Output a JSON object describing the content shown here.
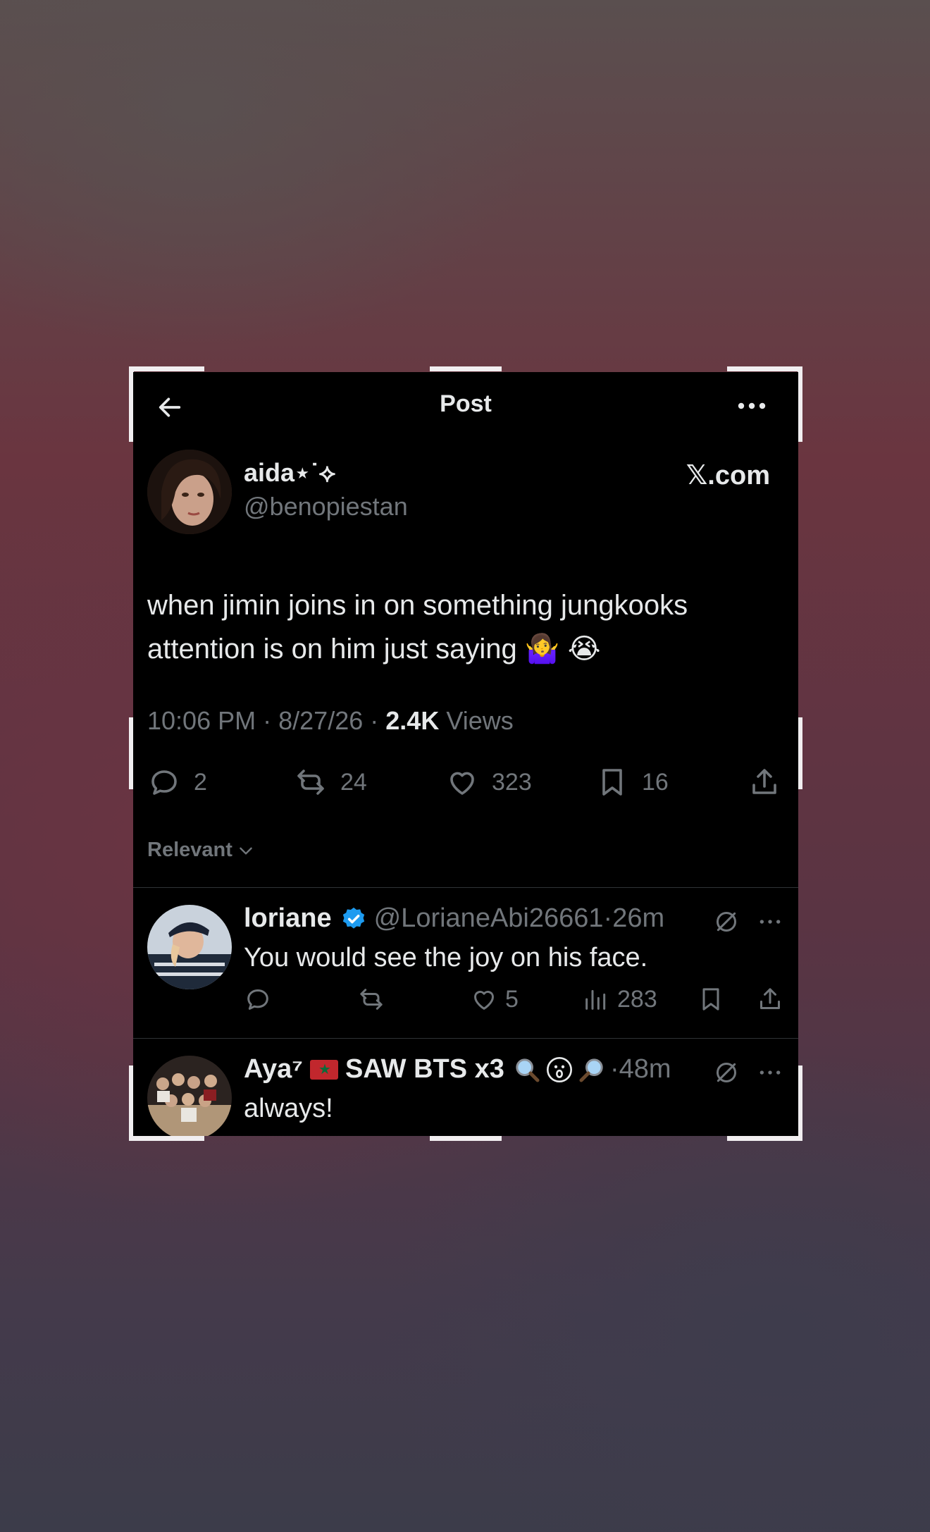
{
  "topbar": {
    "title": "Post"
  },
  "post": {
    "author_name": "aida⋆˙⟡",
    "author_handle": "@benopiestan",
    "source_label": "𝕏.com",
    "text": "when jimin joins in on something jungkooks attention is on him just saying 🤷‍♀️ 😭",
    "time": "10:06 PM",
    "date": "8/27/26",
    "views_count": "2.4K",
    "views_label": "Views",
    "dot": "·",
    "stats": {
      "replies": "2",
      "reposts": "24",
      "likes": "323",
      "bookmarks": "16"
    }
  },
  "sort": {
    "label": "Relevant"
  },
  "replies": [
    {
      "name": "loriane",
      "handle": "@LorianeAbi26661",
      "time": "26m",
      "text": "You would see the joy on his face.",
      "likes": "5",
      "views": "283"
    },
    {
      "name": "Aya⁷",
      "name_suffix": "SAW BTS x3",
      "time": "48m",
      "text": "always!"
    }
  ],
  "colors": {
    "background": "#000000",
    "text": "#e7e9ea",
    "muted": "#71767b",
    "verified": "#1d9bf0",
    "divider": "#2f3336"
  }
}
